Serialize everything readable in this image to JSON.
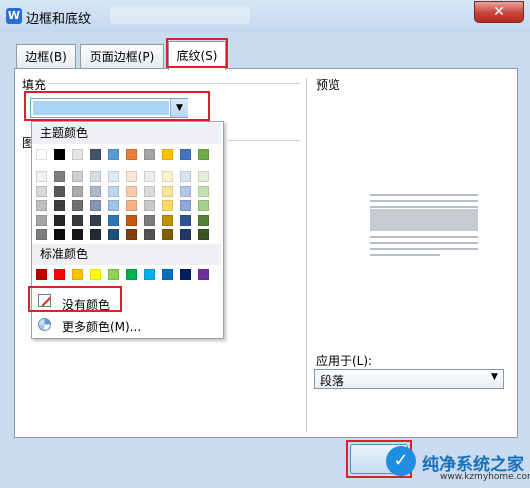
{
  "window": {
    "title": "边框和底纹",
    "app_icon_glyph": "W",
    "close_glyph": "✕"
  },
  "tabs": [
    {
      "label": "边框(B)",
      "selected": false
    },
    {
      "label": "页面边框(P)",
      "selected": false
    },
    {
      "label": "底纹(S)",
      "selected": true
    }
  ],
  "fill": {
    "label": "填充",
    "dropdown_arrow": "▼",
    "selected_color": "#a9d6f8"
  },
  "pattern": {
    "label_partial": "图"
  },
  "color_picker": {
    "theme_label": "主题颜色",
    "theme_top_row": [
      "#ffffff",
      "#000000",
      "#e7e6e6",
      "#44546a",
      "#5b9bd5",
      "#ed7d31",
      "#a5a5a5",
      "#ffc000",
      "#4472c4",
      "#70ad47"
    ],
    "theme_shades": [
      [
        "#f2f2f2",
        "#7f7f7f",
        "#d0cece",
        "#d6dce4",
        "#deebf6",
        "#fbe5d5",
        "#ededed",
        "#fff2cc",
        "#dae3f3",
        "#e2efd9"
      ],
      [
        "#d8d8d8",
        "#595959",
        "#aeaaaa",
        "#adb9ca",
        "#bdd7ee",
        "#f7cbac",
        "#dbdbdb",
        "#fee599",
        "#b4c6e7",
        "#c5e0b3"
      ],
      [
        "#bfbfbf",
        "#3f3f3f",
        "#757070",
        "#8496b0",
        "#9dc3e6",
        "#f4b183",
        "#c9c9c9",
        "#ffd965",
        "#8eaadb",
        "#a8d08d"
      ],
      [
        "#a5a5a5",
        "#262626",
        "#3a3838",
        "#323f4f",
        "#2e75b5",
        "#c55a11",
        "#7b7b7b",
        "#bf9000",
        "#2f5496",
        "#538135"
      ],
      [
        "#7f7f7f",
        "#0c0c0c",
        "#171616",
        "#222a35",
        "#1e4e79",
        "#833c0b",
        "#525252",
        "#7f6000",
        "#1f3864",
        "#375623"
      ]
    ],
    "standard_label": "标准颜色",
    "standard_colors": [
      "#c00000",
      "#ff0000",
      "#ffc000",
      "#ffff00",
      "#92d050",
      "#00b050",
      "#00b0f0",
      "#0070c0",
      "#002060",
      "#7030a0"
    ],
    "no_color_label": "没有颜色",
    "more_colors_label": "更多颜色(M)..."
  },
  "preview": {
    "label": "预览"
  },
  "apply_to": {
    "label": "应用于(L):",
    "value": "段落",
    "arrow": "▼"
  },
  "watermark": {
    "logo_glyph": "✓",
    "title": "纯净系统之家",
    "url": "www.kzmyhome.com"
  },
  "highlight_color": "#d8232a"
}
